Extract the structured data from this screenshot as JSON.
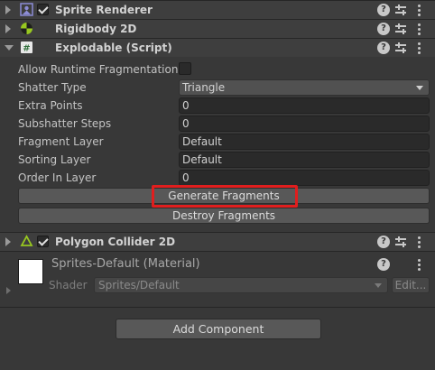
{
  "components": {
    "sprite_renderer": {
      "title": "Sprite Renderer"
    },
    "rigidbody": {
      "title": "Rigidbody 2D"
    },
    "explodable": {
      "title": "Explodable (Script)"
    },
    "polygon_collider": {
      "title": "Polygon Collider 2D"
    }
  },
  "header_icons": {
    "help": "?"
  },
  "explodable_props": {
    "allow_runtime_label": "Allow Runtime Fragmentation",
    "allow_runtime_checked": false,
    "shatter_type_label": "Shatter Type",
    "shatter_type_value": "Triangle",
    "extra_points_label": "Extra Points",
    "extra_points_value": "0",
    "subshatter_label": "Subshatter Steps",
    "subshatter_value": "0",
    "fragment_layer_label": "Fragment Layer",
    "fragment_layer_value": "Default",
    "sorting_layer_label": "Sorting Layer",
    "sorting_layer_value": "Default",
    "order_label": "Order In Layer",
    "order_value": "0",
    "generate_button": "Generate Fragments",
    "destroy_button": "Destroy Fragments"
  },
  "material": {
    "title": "Sprites-Default (Material)",
    "shader_label": "Shader",
    "shader_value": "Sprites/Default",
    "edit_button": "Edit..."
  },
  "footer": {
    "add_component": "Add Component"
  },
  "colors": {
    "highlight": "#e01e1e",
    "background": "#383838",
    "header": "#3e3e3e"
  },
  "icons": [
    "sprite-renderer-icon",
    "rigidbody-icon",
    "script-icon",
    "polygon-collider-icon",
    "help-icon",
    "preset-icon",
    "kebab-menu-icon",
    "checkbox-icon",
    "foldout-arrow-icon",
    "dropdown-arrow-icon"
  ]
}
